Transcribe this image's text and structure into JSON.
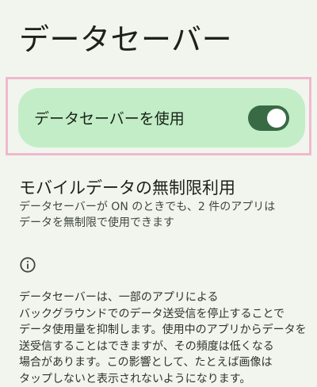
{
  "page": {
    "title": "データセーバー"
  },
  "main_switch": {
    "label": "データセーバーを使用",
    "state": "on"
  },
  "unrestricted_data": {
    "title": "モバイルデータの無制限利用",
    "description_lines": [
      "データセーバーが ON のときでも、2 件のアプリは",
      "データを無制限で使用できます"
    ]
  },
  "footer": {
    "icon": "info-icon",
    "lines": [
      "データセーバーは、一部のアプリによる",
      "バックグラウンドでのデータ送受信を停止することで",
      "データ使用量を抑制します。使用中のアプリからデータを",
      "送受信することはできますが、その頻度は低くなる",
      "場合があります。この影響として、たとえば画像は",
      "タップしないと表示されないようになります。"
    ]
  },
  "colors": {
    "background": "#f1f5ee",
    "card": "#c3edc7",
    "toggle_track": "#386a45",
    "highlight_border": "#f0b8cf"
  }
}
